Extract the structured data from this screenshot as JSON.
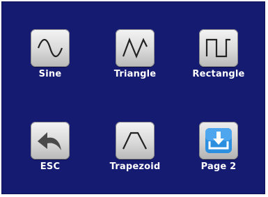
{
  "screen": {
    "background_color": "#161b72",
    "label_color": "#ffffff",
    "tiles": [
      {
        "label": "Sine",
        "icon": "sine-wave-icon"
      },
      {
        "label": "Triangle",
        "icon": "triangle-wave-icon"
      },
      {
        "label": "Rectangle",
        "icon": "rectangle-wave-icon"
      },
      {
        "label": "ESC",
        "icon": "back-arrow-icon"
      },
      {
        "label": "Trapezoid",
        "icon": "trapezoid-wave-icon"
      },
      {
        "label": "Page 2",
        "icon": "page-down-icon"
      }
    ]
  }
}
